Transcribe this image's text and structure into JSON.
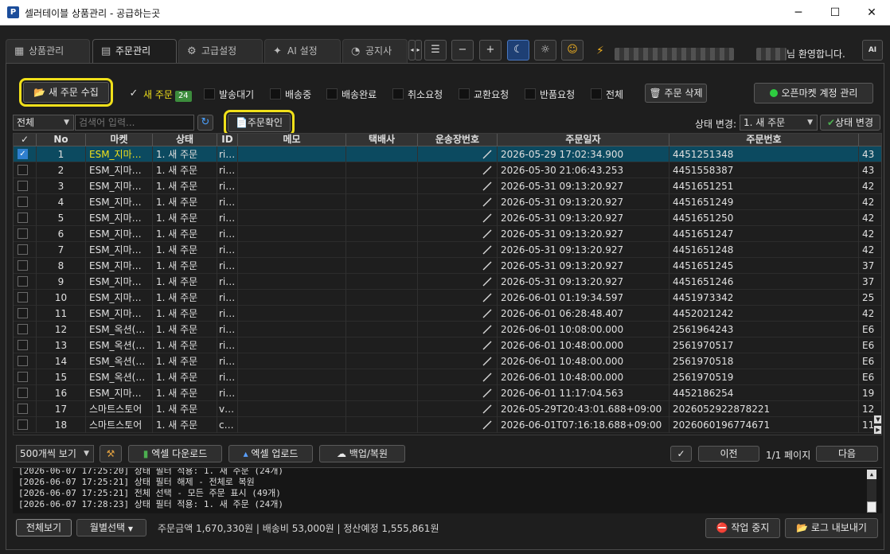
{
  "window": {
    "title": "셀러테이블 상품관리 - 공급하는곳",
    "min": "─",
    "max": "☐",
    "close": "✕"
  },
  "tabs": [
    {
      "label": "상품관리",
      "icon": "grid-icon"
    },
    {
      "label": "주문관리",
      "icon": "clipboard-icon"
    },
    {
      "label": "고급설정",
      "icon": "gear-icon"
    },
    {
      "label": "AI 설정",
      "icon": "sparkle-icon"
    },
    {
      "label": "공지사",
      "icon": "announce-icon"
    }
  ],
  "toolbar": {
    "menu": "☰",
    "zoom_out": "−",
    "zoom_in": "+",
    "moon": "☾",
    "sun": "☼",
    "emoji": "☺",
    "bolt": "⚡",
    "welcome": "님 환영합니다.",
    "ai": "AI"
  },
  "actions": {
    "collect": "새 주문 수집",
    "confirm": "주문확인",
    "delete": "주문 삭제",
    "open_market": "오픈마켓 계정 관리"
  },
  "filters": [
    {
      "label": "새 주문",
      "checked": true,
      "count": "24"
    },
    {
      "label": "발송대기",
      "checked": false
    },
    {
      "label": "배송중",
      "checked": false
    },
    {
      "label": "배송완료",
      "checked": false
    },
    {
      "label": "취소요청",
      "checked": false
    },
    {
      "label": "교환요청",
      "checked": false
    },
    {
      "label": "반품요청",
      "checked": false
    },
    {
      "label": "전체",
      "checked": false
    }
  ],
  "search": {
    "scope": "전체",
    "placeholder": "검색어 입력...",
    "refresh": "↻"
  },
  "status_change": {
    "label": "상태 변경:",
    "value": "1. 새 주문",
    "button": "상태 변경"
  },
  "columns": [
    "✓",
    "No",
    "마켓",
    "상태",
    "ID",
    "메모",
    "택배사",
    "운송장번호",
    "주문일자",
    "주문번호"
  ],
  "rows": [
    {
      "checked": true,
      "no": "1",
      "market": "ESM_지마…",
      "status": "1. 새 주문",
      "id": "ri…",
      "date": "2026-05-29 17:02:34.900",
      "order": "4451251348",
      "extra": "43"
    },
    {
      "checked": false,
      "no": "2",
      "market": "ESM_지마…",
      "status": "1. 새 주문",
      "id": "ri…",
      "date": "2026-05-30 21:06:43.253",
      "order": "4451558387",
      "extra": "43"
    },
    {
      "checked": false,
      "no": "3",
      "market": "ESM_지마…",
      "status": "1. 새 주문",
      "id": "ri…",
      "date": "2026-05-31 09:13:20.927",
      "order": "4451651251",
      "extra": "42"
    },
    {
      "checked": false,
      "no": "4",
      "market": "ESM_지마…",
      "status": "1. 새 주문",
      "id": "ri…",
      "date": "2026-05-31 09:13:20.927",
      "order": "4451651249",
      "extra": "42"
    },
    {
      "checked": false,
      "no": "5",
      "market": "ESM_지마…",
      "status": "1. 새 주문",
      "id": "ri…",
      "date": "2026-05-31 09:13:20.927",
      "order": "4451651250",
      "extra": "42"
    },
    {
      "checked": false,
      "no": "6",
      "market": "ESM_지마…",
      "status": "1. 새 주문",
      "id": "ri…",
      "date": "2026-05-31 09:13:20.927",
      "order": "4451651247",
      "extra": "42"
    },
    {
      "checked": false,
      "no": "7",
      "market": "ESM_지마…",
      "status": "1. 새 주문",
      "id": "ri…",
      "date": "2026-05-31 09:13:20.927",
      "order": "4451651248",
      "extra": "42"
    },
    {
      "checked": false,
      "no": "8",
      "market": "ESM_지마…",
      "status": "1. 새 주문",
      "id": "ri…",
      "date": "2026-05-31 09:13:20.927",
      "order": "4451651245",
      "extra": "37"
    },
    {
      "checked": false,
      "no": "9",
      "market": "ESM_지마…",
      "status": "1. 새 주문",
      "id": "ri…",
      "date": "2026-05-31 09:13:20.927",
      "order": "4451651246",
      "extra": "37"
    },
    {
      "checked": false,
      "no": "10",
      "market": "ESM_지마…",
      "status": "1. 새 주문",
      "id": "ri…",
      "date": "2026-06-01 01:19:34.597",
      "order": "4451973342",
      "extra": "25"
    },
    {
      "checked": false,
      "no": "11",
      "market": "ESM_지마…",
      "status": "1. 새 주문",
      "id": "ri…",
      "date": "2026-06-01 06:28:48.407",
      "order": "4452021242",
      "extra": "42"
    },
    {
      "checked": false,
      "no": "12",
      "market": "ESM_옥션(…",
      "status": "1. 새 주문",
      "id": "ri…",
      "date": "2026-06-01 10:08:00.000",
      "order": "2561964243",
      "extra": "E6"
    },
    {
      "checked": false,
      "no": "13",
      "market": "ESM_옥션(…",
      "status": "1. 새 주문",
      "id": "ri…",
      "date": "2026-06-01 10:48:00.000",
      "order": "2561970517",
      "extra": "E6"
    },
    {
      "checked": false,
      "no": "14",
      "market": "ESM_옥션(…",
      "status": "1. 새 주문",
      "id": "ri…",
      "date": "2026-06-01 10:48:00.000",
      "order": "2561970518",
      "extra": "E6"
    },
    {
      "checked": false,
      "no": "15",
      "market": "ESM_옥션(…",
      "status": "1. 새 주문",
      "id": "ri…",
      "date": "2026-06-01 10:48:00.000",
      "order": "2561970519",
      "extra": "E6"
    },
    {
      "checked": false,
      "no": "16",
      "market": "ESM_지마…",
      "status": "1. 새 주문",
      "id": "ri…",
      "date": "2026-06-01 11:17:04.563",
      "order": "4452186254",
      "extra": "19"
    },
    {
      "checked": false,
      "no": "17",
      "market": "스마트스토어",
      "status": "1. 새 주문",
      "id": "v…",
      "date": "2026-05-29T20:43:01.688+09:00",
      "order": "2026052922878221",
      "extra": "12"
    },
    {
      "checked": false,
      "no": "18",
      "market": "스마트스토어",
      "status": "1. 새 주문",
      "id": "c…",
      "date": "2026-06-01T07:16:18.688+09:00",
      "order": "2026060196774671",
      "extra": "11"
    }
  ],
  "bottom": {
    "per_page": "500개씩 보기",
    "hammer": "⚒",
    "excel_down": "엑셀 다운로드",
    "excel_up": "엑셀 업로드",
    "backup": "백업/복원",
    "check": "✓",
    "prev": "이전",
    "page": "1/1 페이지",
    "next": "다음"
  },
  "log": [
    "[2026-06-07 17:25:20] 상태 필터 적용: 1. 새 주문 (24개)",
    "[2026-06-07 17:25:21] 상태 필터 해제 - 전체로 복원",
    "[2026-06-07 17:25:21] 전체 선택 - 모든 주문 표시 (49개)",
    "[2026-06-07 17:28:23] 상태 필터 적용: 1. 새 주문 (24개)"
  ],
  "footer": {
    "view_all": "전체보기",
    "month": "월별선택",
    "summary": "주문금액 1,670,330원  |  배송비 53,000원  |  정산예정 1,555,861원",
    "stop": "작업 중지",
    "export_log": "로그 내보내기"
  },
  "colors": {
    "selected_row": "#0c4a60",
    "market_highlight": "#f0e01a",
    "badge": "#3c8c3c",
    "highlight_box": "#f0e01a"
  }
}
